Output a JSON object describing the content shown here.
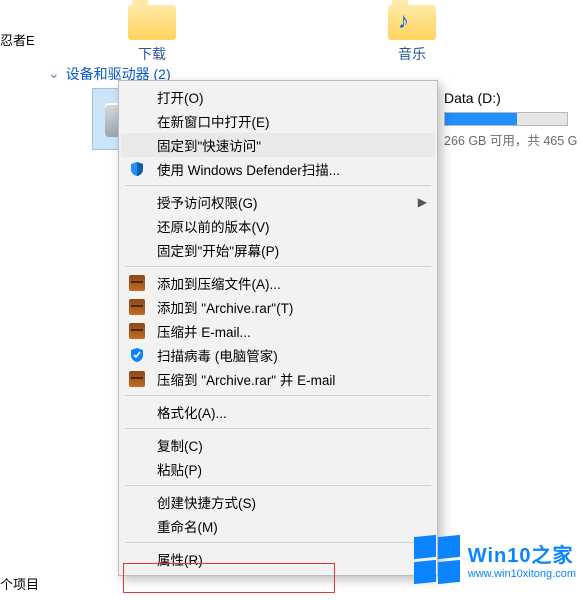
{
  "top_folders": {
    "downloads": "下载",
    "music": "音乐"
  },
  "left_truncated_label": "忍者E",
  "section_header": "设备和驱动器 (2)",
  "data_drive": {
    "label": "Data (D:)",
    "stats": "266 GB 可用，共 465 G"
  },
  "context_menu": {
    "open": "打开(O)",
    "open_new_window": "在新窗口中打开(E)",
    "pin_quick_access": "固定到\"快速访问\"",
    "defender_scan": "使用 Windows Defender扫描...",
    "grant_access": "授予访问权限(G)",
    "restore_previous": "还原以前的版本(V)",
    "pin_start": "固定到\"开始\"屏幕(P)",
    "add_to_archive": "添加到压缩文件(A)...",
    "add_to_archive_rar": "添加到 \"Archive.rar\"(T)",
    "compress_email": "压缩并 E-mail...",
    "scan_virus": "扫描病毒 (电脑管家)",
    "compress_rar_email": "压缩到 \"Archive.rar\" 并 E-mail",
    "format": "格式化(A)...",
    "copy": "复制(C)",
    "paste": "粘贴(P)",
    "create_shortcut": "创建快捷方式(S)",
    "rename": "重命名(M)",
    "properties": "属性(R)"
  },
  "bottom_label": "个项目",
  "watermark": {
    "title": "Win10之家",
    "url": "www.win10xitong.com"
  }
}
